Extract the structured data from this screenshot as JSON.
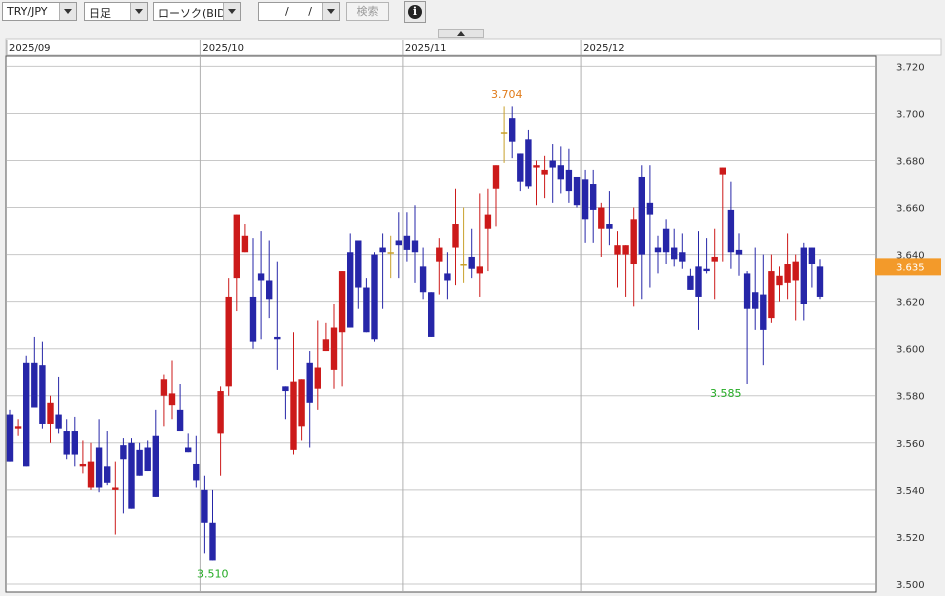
{
  "toolbar": {
    "symbol": "TRY/JPY",
    "timeframe": "日足",
    "chart_type": "ローソク(BID)",
    "date_value": "/ /",
    "search_label": "検索",
    "info_glyph": "i",
    "collapse_icon": "triangle-up-icon"
  },
  "chart_data": {
    "type": "candlestick",
    "series_label": "BID",
    "x_labels": [
      "2025/09",
      "2025/10",
      "2025/11",
      "2025/12"
    ],
    "y_ticks": [
      "3.720",
      "3.700",
      "3.680",
      "3.660",
      "3.640",
      "3.620",
      "3.600",
      "3.580",
      "3.560",
      "3.540",
      "3.520",
      "3.500"
    ],
    "ylim": [
      3.497,
      3.724
    ],
    "current_price": "3.635",
    "high_label": "3.704",
    "low_label": "3.510",
    "local_low_label": "3.585",
    "grid": true,
    "colors": {
      "up": "#cc1a1a",
      "down": "#2626a8",
      "doji": "#c8a02a",
      "current_price_bg": "#f39a2a",
      "high_label": "#e07b1a",
      "low_label": "#22aa22",
      "grid": "#c8c8c8"
    },
    "candles": [
      [
        3.572,
        3.574,
        3.552,
        3.552
      ],
      [
        3.566,
        3.57,
        3.563,
        3.567
      ],
      [
        3.594,
        3.597,
        3.55,
        3.55
      ],
      [
        3.594,
        3.605,
        3.577,
        3.575
      ],
      [
        3.593,
        3.603,
        3.566,
        3.568
      ],
      [
        3.568,
        3.58,
        3.56,
        3.577
      ],
      [
        3.572,
        3.588,
        3.564,
        3.566
      ],
      [
        3.565,
        3.57,
        3.553,
        3.555
      ],
      [
        3.565,
        3.571,
        3.55,
        3.555
      ],
      [
        3.55,
        3.561,
        3.547,
        3.551
      ],
      [
        3.541,
        3.56,
        3.54,
        3.552
      ],
      [
        3.558,
        3.57,
        3.539,
        3.541
      ],
      [
        3.55,
        3.565,
        3.542,
        3.543
      ],
      [
        3.54,
        3.552,
        3.521,
        3.541
      ],
      [
        3.559,
        3.562,
        3.53,
        3.553
      ],
      [
        3.56,
        3.562,
        3.532,
        3.532
      ],
      [
        3.557,
        3.56,
        3.547,
        3.546
      ],
      [
        3.558,
        3.561,
        3.548,
        3.548
      ],
      [
        3.563,
        3.574,
        3.543,
        3.537
      ],
      [
        3.58,
        3.589,
        3.567,
        3.587
      ],
      [
        3.576,
        3.595,
        3.57,
        3.581
      ],
      [
        3.574,
        3.585,
        3.566,
        3.565
      ],
      [
        3.558,
        3.564,
        3.557,
        3.556
      ],
      [
        3.551,
        3.563,
        3.541,
        3.544
      ],
      [
        3.54,
        3.546,
        3.513,
        3.526
      ],
      [
        3.526,
        3.54,
        3.51,
        3.51
      ],
      [
        3.564,
        3.584,
        3.546,
        3.582
      ],
      [
        3.584,
        3.63,
        3.58,
        3.622
      ],
      [
        3.63,
        3.657,
        3.616,
        3.657
      ],
      [
        3.641,
        3.653,
        3.641,
        3.648
      ],
      [
        3.622,
        3.647,
        3.6,
        3.603
      ],
      [
        3.632,
        3.65,
        3.604,
        3.629
      ],
      [
        3.629,
        3.646,
        3.613,
        3.621
      ],
      [
        3.605,
        3.637,
        3.591,
        3.604
      ],
      [
        3.584,
        3.584,
        3.57,
        3.582
      ],
      [
        3.557,
        3.607,
        3.555,
        3.586
      ],
      [
        3.567,
        3.584,
        3.561,
        3.587
      ],
      [
        3.594,
        3.599,
        3.558,
        3.577
      ],
      [
        3.583,
        3.612,
        3.574,
        3.592
      ],
      [
        3.599,
        3.611,
        3.605,
        3.604
      ],
      [
        3.591,
        3.619,
        3.583,
        3.609
      ],
      [
        3.607,
        3.626,
        3.584,
        3.633
      ],
      [
        3.641,
        3.649,
        3.609,
        3.609
      ],
      [
        3.646,
        3.644,
        3.617,
        3.626
      ],
      [
        3.626,
        3.63,
        3.612,
        3.607
      ],
      [
        3.64,
        3.641,
        3.603,
        3.604
      ],
      [
        3.643,
        3.649,
        3.617,
        3.641
      ],
      [
        3.641,
        3.648,
        3.63,
        3.641
      ],
      [
        3.646,
        3.658,
        3.63,
        3.644
      ],
      [
        3.648,
        3.658,
        3.637,
        3.642
      ],
      [
        3.646,
        3.661,
        3.628,
        3.641
      ],
      [
        3.635,
        3.643,
        3.621,
        3.624
      ],
      [
        3.624,
        3.62,
        3.611,
        3.605
      ],
      [
        3.637,
        3.647,
        3.623,
        3.643
      ],
      [
        3.632,
        3.641,
        3.621,
        3.629
      ],
      [
        3.643,
        3.668,
        3.627,
        3.653
      ],
      [
        3.636,
        3.66,
        3.628,
        3.636
      ],
      [
        3.639,
        3.651,
        3.63,
        3.634
      ],
      [
        3.632,
        3.666,
        3.622,
        3.635
      ],
      [
        3.651,
        3.668,
        3.633,
        3.657
      ],
      [
        3.668,
        3.677,
        3.652,
        3.678
      ],
      [
        3.692,
        3.703,
        3.679,
        3.692
      ],
      [
        3.698,
        3.703,
        3.681,
        3.688
      ],
      [
        3.683,
        3.681,
        3.667,
        3.671
      ],
      [
        3.689,
        3.693,
        3.668,
        3.669
      ],
      [
        3.677,
        3.68,
        3.661,
        3.678
      ],
      [
        3.674,
        3.682,
        3.664,
        3.676
      ],
      [
        3.68,
        3.687,
        3.662,
        3.677
      ],
      [
        3.678,
        3.686,
        3.666,
        3.672
      ],
      [
        3.676,
        3.685,
        3.662,
        3.667
      ],
      [
        3.673,
        3.669,
        3.66,
        3.661
      ],
      [
        3.672,
        3.676,
        3.645,
        3.655
      ],
      [
        3.67,
        3.676,
        3.645,
        3.659
      ],
      [
        3.651,
        3.662,
        3.639,
        3.66
      ],
      [
        3.653,
        3.667,
        3.644,
        3.651
      ],
      [
        3.64,
        3.65,
        3.626,
        3.644
      ],
      [
        3.64,
        3.641,
        3.622,
        3.644
      ],
      [
        3.636,
        3.66,
        3.618,
        3.655
      ],
      [
        3.673,
        3.678,
        3.621,
        3.64
      ],
      [
        3.662,
        3.678,
        3.626,
        3.657
      ],
      [
        3.643,
        3.648,
        3.632,
        3.641
      ],
      [
        3.651,
        3.655,
        3.636,
        3.641
      ],
      [
        3.643,
        3.651,
        3.635,
        3.638
      ],
      [
        3.641,
        3.649,
        3.634,
        3.637
      ],
      [
        3.631,
        3.634,
        3.631,
        3.625
      ],
      [
        3.635,
        3.65,
        3.608,
        3.622
      ],
      [
        3.634,
        3.647,
        3.632,
        3.633
      ],
      [
        3.637,
        3.651,
        3.621,
        3.639
      ],
      [
        3.674,
        3.677,
        3.637,
        3.677
      ],
      [
        3.659,
        3.671,
        3.634,
        3.641
      ],
      [
        3.642,
        3.649,
        3.631,
        3.64
      ],
      [
        3.632,
        3.633,
        3.585,
        3.617
      ],
      [
        3.624,
        3.643,
        3.608,
        3.617
      ],
      [
        3.623,
        3.64,
        3.593,
        3.608
      ],
      [
        3.613,
        3.64,
        3.611,
        3.633
      ],
      [
        3.627,
        3.635,
        3.62,
        3.631
      ],
      [
        3.628,
        3.649,
        3.621,
        3.636
      ],
      [
        3.629,
        3.64,
        3.612,
        3.637
      ],
      [
        3.643,
        3.645,
        3.612,
        3.619
      ],
      [
        3.643,
        3.637,
        3.626,
        3.636
      ],
      [
        3.635,
        3.638,
        3.621,
        3.622
      ]
    ]
  }
}
